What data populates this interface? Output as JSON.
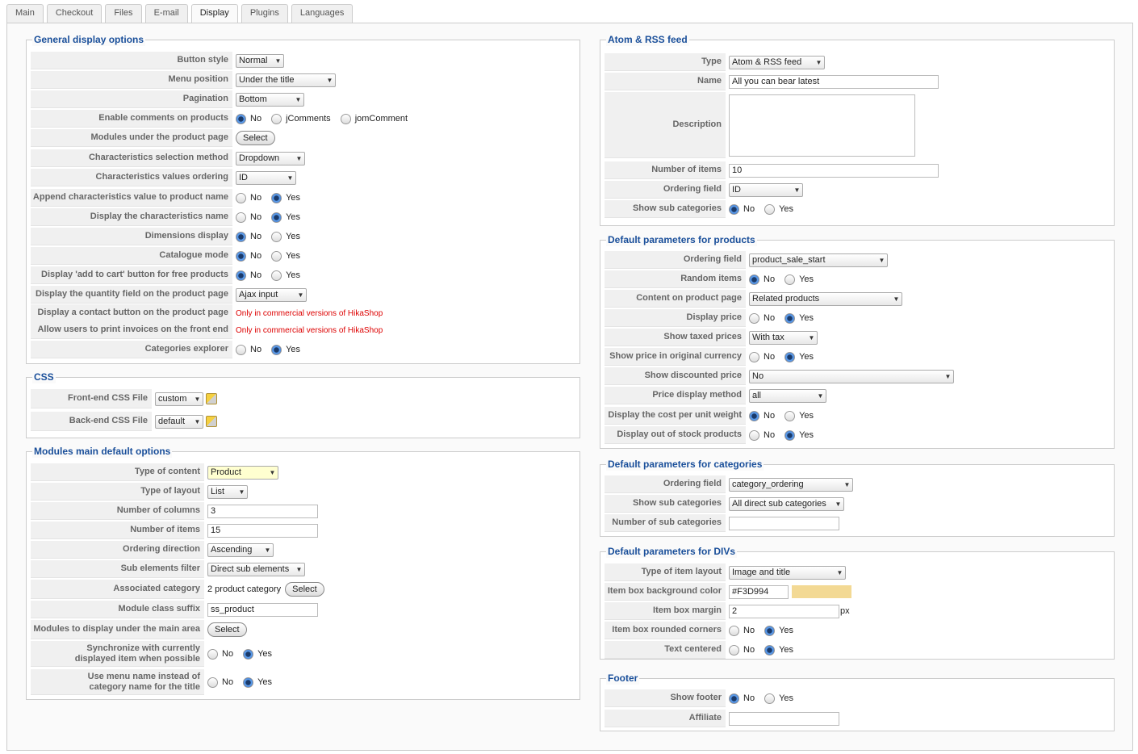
{
  "tabs": [
    "Main",
    "Checkout",
    "Files",
    "E-mail",
    "Display",
    "Plugins",
    "Languages"
  ],
  "general": {
    "legend": "General display options",
    "button_style": {
      "label": "Button style",
      "value": "Normal"
    },
    "menu_position": {
      "label": "Menu position",
      "value": "Under the title"
    },
    "pagination": {
      "label": "Pagination",
      "value": "Bottom"
    },
    "comments": {
      "label": "Enable comments on products",
      "o1": "No",
      "o2": "jComments",
      "o3": "jomComment"
    },
    "modules_under": {
      "label": "Modules under the product page",
      "btn": "Select"
    },
    "char_sel": {
      "label": "Characteristics selection method",
      "value": "Dropdown"
    },
    "char_order": {
      "label": "Characteristics values ordering",
      "value": "ID"
    },
    "append_char": {
      "label": "Append characteristics value to product name",
      "no": "No",
      "yes": "Yes"
    },
    "display_char": {
      "label": "Display the characteristics name",
      "no": "No",
      "yes": "Yes"
    },
    "dimensions": {
      "label": "Dimensions display",
      "no": "No",
      "yes": "Yes"
    },
    "catalogue": {
      "label": "Catalogue mode",
      "no": "No",
      "yes": "Yes"
    },
    "addcart": {
      "label": "Display 'add to cart' button for free products",
      "no": "No",
      "yes": "Yes"
    },
    "quantity": {
      "label": "Display the quantity field on the product page",
      "value": "Ajax input"
    },
    "contact": {
      "label": "Display a contact button on the product page",
      "note": "Only in commercial versions of HikaShop"
    },
    "invoices": {
      "label": "Allow users to print invoices on the front end",
      "note": "Only in commercial versions of HikaShop"
    },
    "cat_explorer": {
      "label": "Categories explorer",
      "no": "No",
      "yes": "Yes"
    }
  },
  "css": {
    "legend": "CSS",
    "front": {
      "label": "Front-end CSS File",
      "value": "custom"
    },
    "back": {
      "label": "Back-end CSS File",
      "value": "default"
    }
  },
  "modules": {
    "legend": "Modules main default options",
    "content": {
      "label": "Type of content",
      "value": "Product"
    },
    "layout": {
      "label": "Type of layout",
      "value": "List"
    },
    "columns": {
      "label": "Number of columns",
      "value": "3"
    },
    "items": {
      "label": "Number of items",
      "value": "15"
    },
    "direction": {
      "label": "Ordering direction",
      "value": "Ascending"
    },
    "sub_filter": {
      "label": "Sub elements filter",
      "value": "Direct sub elements"
    },
    "assoc": {
      "label": "Associated category",
      "value": "2 product category",
      "btn": "Select"
    },
    "suffix": {
      "label": "Module class suffix",
      "value": "ss_product"
    },
    "display_under": {
      "label": "Modules to display under the main area",
      "btn": "Select"
    },
    "sync": {
      "label1": "Synchronize with currently",
      "label2": "displayed item when possible",
      "no": "No",
      "yes": "Yes"
    },
    "menuname": {
      "label1": "Use menu name instead of",
      "label2": "category name for the title",
      "no": "No",
      "yes": "Yes"
    }
  },
  "feed": {
    "legend": "Atom & RSS feed",
    "type": {
      "label": "Type",
      "value": "Atom & RSS feed"
    },
    "name": {
      "label": "Name",
      "value": "All you can bear latest"
    },
    "description": {
      "label": "Description"
    },
    "num": {
      "label": "Number of items",
      "value": "10"
    },
    "order": {
      "label": "Ordering field",
      "value": "ID"
    },
    "subcats": {
      "label": "Show sub categories",
      "no": "No",
      "yes": "Yes"
    }
  },
  "products": {
    "legend": "Default parameters for products",
    "order": {
      "label": "Ordering field",
      "value": "product_sale_start"
    },
    "random": {
      "label": "Random items",
      "no": "No",
      "yes": "Yes"
    },
    "content": {
      "label": "Content on product page",
      "value": "Related products"
    },
    "price": {
      "label": "Display price",
      "no": "No",
      "yes": "Yes"
    },
    "taxed": {
      "label": "Show taxed prices",
      "value": "With tax"
    },
    "orig_currency": {
      "label": "Show price in original currency",
      "no": "No",
      "yes": "Yes"
    },
    "discounted": {
      "label": "Show discounted price",
      "value": "No"
    },
    "method": {
      "label": "Price display method",
      "value": "all"
    },
    "cost_unit": {
      "label": "Display the cost per unit weight",
      "no": "No",
      "yes": "Yes"
    },
    "out_stock": {
      "label": "Display out of stock products",
      "no": "No",
      "yes": "Yes"
    }
  },
  "categories": {
    "legend": "Default parameters for categories",
    "order": {
      "label": "Ordering field",
      "value": "category_ordering"
    },
    "subcats": {
      "label": "Show sub categories",
      "value": "All direct sub categories"
    },
    "num": {
      "label": "Number of sub categories",
      "value": ""
    }
  },
  "divs": {
    "legend": "Default parameters for DIVs",
    "layout": {
      "label": "Type of item layout",
      "value": "Image and title"
    },
    "bg": {
      "label": "Item box background color",
      "value": "#F3D994",
      "color": "#F3D994"
    },
    "margin": {
      "label": "Item box margin",
      "value": "2",
      "unit": "px"
    },
    "rounded": {
      "label": "Item box rounded corners",
      "no": "No",
      "yes": "Yes"
    },
    "centered": {
      "label": "Text centered",
      "no": "No",
      "yes": "Yes"
    }
  },
  "footer": {
    "legend": "Footer",
    "show": {
      "label": "Show footer",
      "no": "No",
      "yes": "Yes"
    },
    "affiliate": {
      "label": "Affiliate",
      "value": ""
    }
  }
}
